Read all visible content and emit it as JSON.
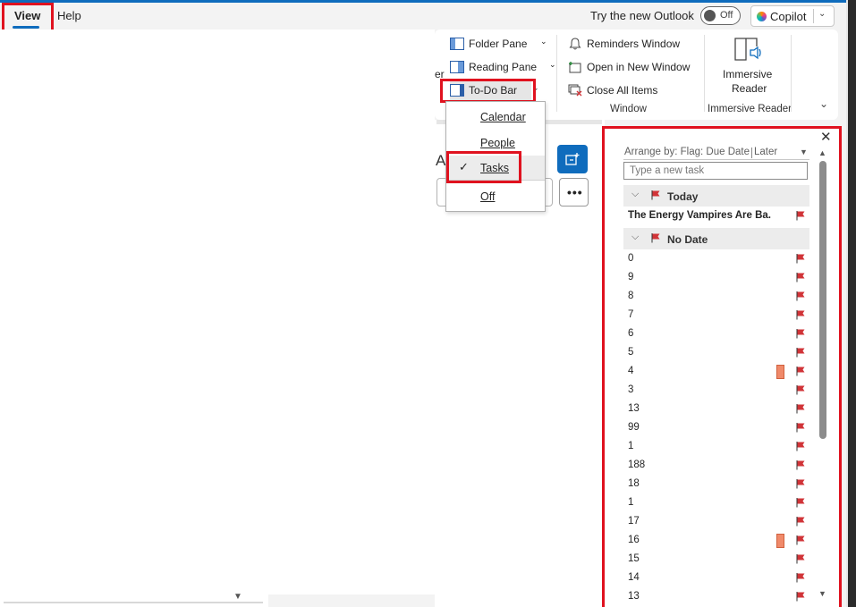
{
  "tabs": {
    "view": "View",
    "help": "Help"
  },
  "header": {
    "try_new_outlook": "Try the new Outlook",
    "toggle_state": "Off",
    "copilot": "Copilot"
  },
  "ribbon": {
    "partial_label": "er",
    "layout": {
      "folder_pane": "Folder Pane",
      "reading_pane": "Reading Pane",
      "todo_bar": "To-Do Bar"
    },
    "window": {
      "reminders": "Reminders Window",
      "open_new": "Open in New Window",
      "close_all": "Close All Items",
      "group_label": "Window"
    },
    "immersive": {
      "button_line1": "Immersive",
      "button_line2": "Reader",
      "group_label": "Immersive Reader"
    }
  },
  "todo_dropdown": {
    "items": [
      "Calendar",
      "People",
      "Tasks",
      "Off"
    ],
    "checked": "Tasks"
  },
  "middle": {
    "partial_letter": "A"
  },
  "todo_bar": {
    "arrange_by": "Arrange by: Flag: Due Date",
    "arrange_order": "Later",
    "new_task_placeholder": "Type a new task",
    "groups": {
      "today": "Today",
      "no_date": "No Date"
    },
    "today_tasks": [
      "The Energy Vampires Are Ba..."
    ],
    "no_date_tasks": [
      "0",
      "9",
      "8",
      "7",
      "6",
      "5",
      "4",
      "3",
      "13",
      "99",
      "1",
      "188",
      "18",
      "1",
      "17",
      "16",
      "15",
      "14",
      "13"
    ],
    "category_marked": [
      "4",
      "16"
    ]
  },
  "colors": {
    "accent": "#0f6cbd",
    "flag": "#d13438",
    "highlight_box": "#e0121f",
    "category": "#f08a6a"
  }
}
